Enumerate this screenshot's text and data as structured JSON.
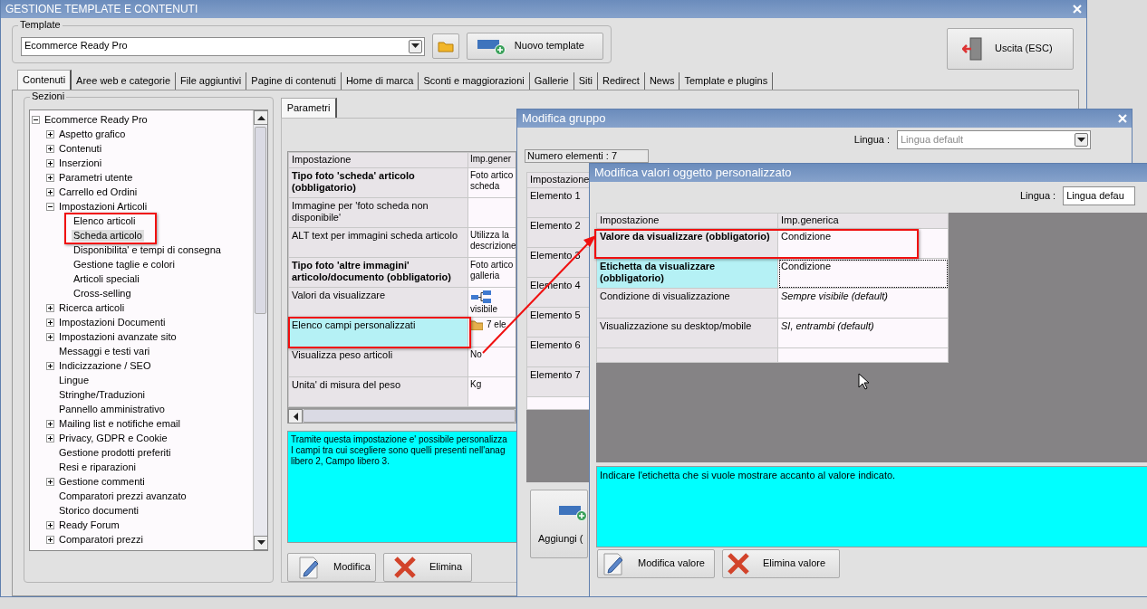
{
  "window": {
    "title": "GESTIONE TEMPLATE E CONTENUTI"
  },
  "template": {
    "legend": "Template",
    "value": "Ecommerce Ready Pro",
    "new_button": "Nuovo template"
  },
  "exit_button": "Uscita (ESC)",
  "tabs": [
    {
      "label": "Contenuti",
      "selected": true
    },
    {
      "label": "Aree web e categorie",
      "selected": false
    },
    {
      "label": "File aggiuntivi",
      "selected": false
    },
    {
      "label": "Pagine di contenuti",
      "selected": false
    },
    {
      "label": "Home di marca",
      "selected": false
    },
    {
      "label": "Sconti e maggiorazioni",
      "selected": false
    },
    {
      "label": "Gallerie",
      "selected": false
    },
    {
      "label": "Siti",
      "selected": false
    },
    {
      "label": "Redirect",
      "selected": false
    },
    {
      "label": "News",
      "selected": false
    },
    {
      "label": "Template e plugins",
      "selected": false
    }
  ],
  "sections": {
    "legend": "Sezioni",
    "tree": [
      {
        "label": "Ecommerce Ready Pro",
        "expanded": true,
        "selected": false,
        "children": [
          {
            "label": "Aspetto grafico",
            "expanded": false,
            "selected": false
          },
          {
            "label": "Contenuti",
            "expanded": false,
            "selected": false
          },
          {
            "label": "Inserzioni",
            "expanded": false,
            "selected": false
          },
          {
            "label": "Parametri utente",
            "expanded": false,
            "selected": false
          },
          {
            "label": "Carrello ed Ordini",
            "expanded": false,
            "selected": false
          },
          {
            "label": "Impostazioni Articoli",
            "expanded": true,
            "selected": false,
            "children": [
              {
                "label": "Elenco articoli",
                "selected": false
              },
              {
                "label": "Scheda articolo",
                "selected": true
              },
              {
                "label": "Disponibilita' e tempi di consegna",
                "selected": false
              },
              {
                "label": "Gestione taglie e colori",
                "selected": false
              },
              {
                "label": "Articoli speciali",
                "selected": false
              },
              {
                "label": "Cross-selling",
                "selected": false
              }
            ]
          },
          {
            "label": "Ricerca articoli",
            "expanded": false,
            "selected": false
          },
          {
            "label": "Impostazioni Documenti",
            "expanded": false,
            "selected": false
          },
          {
            "label": "Impostazioni avanzate sito",
            "expanded": false,
            "selected": false
          },
          {
            "label": "Messaggi e testi vari",
            "selected": false
          },
          {
            "label": "Indicizzazione / SEO",
            "expanded": false,
            "selected": false
          },
          {
            "label": "Lingue",
            "selected": false
          },
          {
            "label": "Stringhe/Traduzioni",
            "selected": false
          },
          {
            "label": "Pannello amministrativo",
            "selected": false
          },
          {
            "label": "Mailing list e notifiche email",
            "expanded": false,
            "selected": false
          },
          {
            "label": "Privacy, GDPR e Cookie",
            "expanded": false,
            "selected": false
          },
          {
            "label": "Gestione prodotti preferiti",
            "selected": false
          },
          {
            "label": "Resi e riparazioni",
            "selected": false
          },
          {
            "label": "Gestione commenti",
            "expanded": false,
            "selected": false
          },
          {
            "label": "Comparatori prezzi avanzato",
            "selected": false
          },
          {
            "label": "Storico documenti",
            "selected": false
          },
          {
            "label": "Ready Forum",
            "expanded": false,
            "selected": false
          },
          {
            "label": "Comparatori prezzi",
            "expanded": false,
            "selected": false
          }
        ]
      }
    ]
  },
  "parameters": {
    "tab": {
      "label": "Parametri",
      "selected": true
    },
    "columns": [
      "Impostazione",
      "Imp.gener"
    ],
    "rows": [
      {
        "name": "Tipo foto 'scheda' articolo (obbligatorio)",
        "value": "Foto artico\nscheda",
        "kind": "text",
        "bold": true,
        "selected": false
      },
      {
        "name": "Immagine per 'foto scheda non disponibile'",
        "value": "",
        "kind": "text",
        "bold": false,
        "selected": false
      },
      {
        "name": "ALT text per immagini scheda articolo",
        "value": "Utilizza la\ndescrizione",
        "kind": "text",
        "bold": false,
        "selected": false
      },
      {
        "name": "Tipo foto 'altre immagini' articolo/documento (obbligatorio)",
        "value": "Foto artico\ngalleria",
        "kind": "text",
        "bold": true,
        "selected": false
      },
      {
        "name": "Valori da visualizzare",
        "value": "visibile",
        "kind": "group",
        "bold": false,
        "selected": false
      },
      {
        "name": "Elenco campi personalizzati",
        "value": "7 ele",
        "kind": "list",
        "bold": false,
        "selected": true
      },
      {
        "name": "Visualizza peso articoli",
        "value": "No",
        "kind": "text",
        "bold": false,
        "selected": false
      },
      {
        "name": "Unita' di misura del peso",
        "value": "Kg",
        "kind": "text",
        "bold": false,
        "selected": false
      }
    ],
    "description": "Tramite questa impostazione e' possibile personalizza\nI campi tra cui scegliere sono quelli presenti nell'anag\nlibero 2, Campo libero 3.",
    "buttons": [
      {
        "label": "Modifica",
        "kind": "edit"
      },
      {
        "label": "Elimina",
        "kind": "delete"
      }
    ]
  },
  "group_dialog": {
    "title": "Modifica gruppo",
    "language_label": "Lingua :",
    "language": "Lingua default",
    "count": "Numero elementi : 7",
    "column": "Impostazione",
    "items": [
      "Elemento 1",
      "Elemento 2",
      "Elemento 3",
      "Elemento 4",
      "Elemento 5",
      "Elemento 6",
      "Elemento 7"
    ],
    "add_button": "Aggiungi ("
  },
  "value_dialog": {
    "title": "Modifica valori oggetto personalizzato",
    "language_label": "Lingua :",
    "language": "Lingua defau",
    "columns": [
      "Impostazione",
      "Imp.generica"
    ],
    "rows": [
      {
        "name": "Valore da visualizzare (obbligatorio)",
        "value": "Condizione",
        "bold": true,
        "italic": false,
        "selected": false
      },
      {
        "name": "Etichetta da visualizzare (obbligatorio)",
        "value": "Condizione",
        "bold": true,
        "italic": false,
        "selected": true
      },
      {
        "name": "Condizione di visualizzazione",
        "value": "Sempre visibile (default)",
        "bold": false,
        "italic": true,
        "selected": false
      },
      {
        "name": "Visualizzazione su desktop/mobile",
        "value": "SI, entrambi (default)",
        "bold": false,
        "italic": true,
        "selected": false
      }
    ],
    "description": "Indicare l'etichetta che si vuole mostrare accanto al valore indicato.",
    "buttons": [
      {
        "label": "Modifica valore",
        "kind": "edit"
      },
      {
        "label": "Elimina valore",
        "kind": "delete"
      }
    ]
  }
}
